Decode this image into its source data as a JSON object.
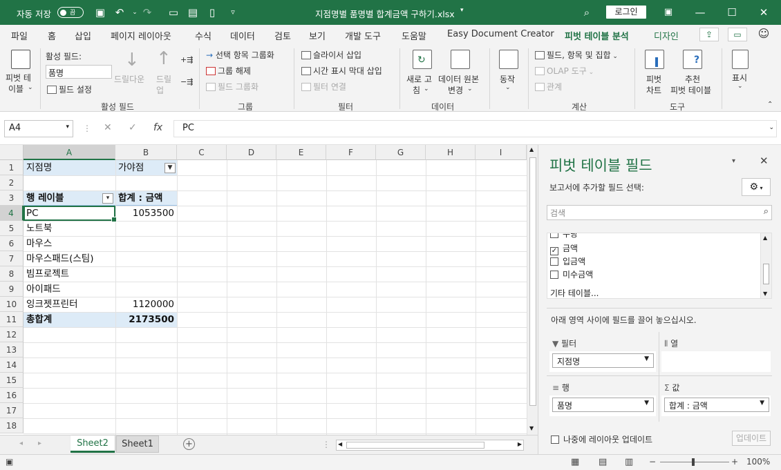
{
  "titlebar": {
    "autosave_label": "자동 저장",
    "autosave_state": "끔",
    "filename": "지점명별 품명별 합계금액 구하기.xlsx",
    "login_label": "로그인"
  },
  "tabs": [
    {
      "label": "파일"
    },
    {
      "label": "홈"
    },
    {
      "label": "삽입"
    },
    {
      "label": "페이지 레이아웃"
    },
    {
      "label": "수식"
    },
    {
      "label": "데이터"
    },
    {
      "label": "검토"
    },
    {
      "label": "보기"
    },
    {
      "label": "개발 도구"
    },
    {
      "label": "도움말"
    },
    {
      "label": "Easy Document Creator"
    },
    {
      "label": "피벗 테이블 분석"
    },
    {
      "label": "디자인"
    }
  ],
  "ribbon": {
    "pivot_table": [
      "피벗 테",
      "이블"
    ],
    "active_field_label": "활성 필드:",
    "active_field_value": "품명",
    "drill_down": "드릴다운",
    "drill_up": [
      "드릴",
      "업"
    ],
    "field_settings": "필드 설정",
    "group_active_field": "활성 필드",
    "group_selection": "선택 항목 그룹화",
    "ungroup": "그룹 해제",
    "group_field": "필드 그룹화",
    "group_group": "그룹",
    "insert_slicer": "슬라이서 삽입",
    "insert_timeline": "시간 표시 막대 삽입",
    "filter_connections": "필터 연결",
    "group_filter": "필터",
    "refresh": [
      "새로 고",
      "침"
    ],
    "change_source": [
      "데이터 원본",
      "변경"
    ],
    "group_data": "데이터",
    "actions": "동작",
    "fields_items_sets": "필드, 항목 및 집합",
    "olap_tools": "OLAP 도구",
    "relationships": "관계",
    "group_calculations": "계산",
    "pivot_chart": [
      "피벗",
      "차트"
    ],
    "recommended": [
      "추천",
      "피벗 테이블"
    ],
    "group_tools": "도구",
    "show": "표시"
  },
  "formula_bar": {
    "name_box": "A4",
    "formula": "PC"
  },
  "grid": {
    "columns": [
      "A",
      "B",
      "C",
      "D",
      "E",
      "F",
      "G",
      "H",
      "I"
    ],
    "rows": [
      "1",
      "2",
      "3",
      "4",
      "5",
      "6",
      "7",
      "8",
      "9",
      "10",
      "11",
      "12",
      "13",
      "14",
      "15",
      "16",
      "17",
      "18"
    ]
  },
  "pivot": {
    "filter_field": "지점명",
    "filter_value": "가야점",
    "row_label_header": "행 레이블",
    "value_header": "합계 : 금액",
    "rows": [
      {
        "label": "PC",
        "value": "1053500"
      },
      {
        "label": "노트북",
        "value": ""
      },
      {
        "label": "마우스",
        "value": ""
      },
      {
        "label": "마우스패드(스팀)",
        "value": ""
      },
      {
        "label": "빔프로젝트",
        "value": ""
      },
      {
        "label": "아이패드",
        "value": ""
      },
      {
        "label": "잉크젯프린터",
        "value": "1120000"
      }
    ],
    "total_label": "총합계",
    "total_value": "2173500"
  },
  "sheets": [
    {
      "name": "Sheet2",
      "active": true
    },
    {
      "name": "Sheet1",
      "active": false
    }
  ],
  "pane": {
    "title": "피벗 테이블 필드",
    "subtitle": "보고서에 추가할 필드 선택:",
    "search_placeholder": "검색",
    "fields": [
      {
        "name": "수량",
        "checked": false
      },
      {
        "name": "금액",
        "checked": true
      },
      {
        "name": "입금액",
        "checked": false
      },
      {
        "name": "미수금액",
        "checked": false
      }
    ],
    "more_tables": "기타 테이블...",
    "drag_hint": "아래 영역 사이에 필드를 끌어 놓으십시오.",
    "filters_label": "필터",
    "columns_label": "열",
    "rows_label": "행",
    "values_label": "값",
    "filters_item": "지점명",
    "rows_item": "품명",
    "values_item": "합계 : 금액",
    "defer_label": "나중에 레이아웃 업데이트",
    "update_label": "업데이트"
  },
  "status": {
    "zoom": "100%"
  },
  "colors": {
    "excel_green": "#217346",
    "pivot_band": "#ddebf7"
  }
}
